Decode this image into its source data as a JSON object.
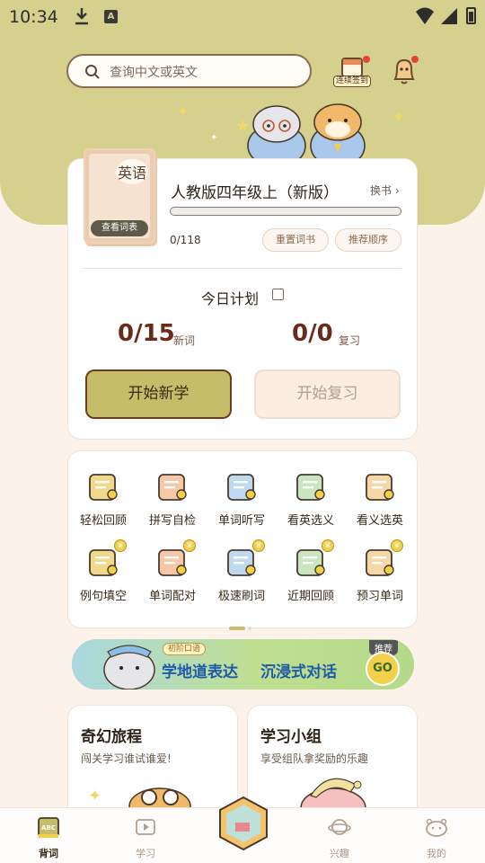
{
  "status_bar": {
    "time": "10:34"
  },
  "search": {
    "placeholder": "查询中文或英文"
  },
  "header": {
    "checkin_label": "连续签到"
  },
  "book": {
    "cover_title": "英语",
    "view_words": "查看词表",
    "title": "人教版四年级上（新版）",
    "change": "换书",
    "progress_text": "0/118",
    "progress_fraction": 0.0,
    "reset": "重置词书",
    "order": "推荐顺序"
  },
  "plan": {
    "title": "今日计划",
    "new_value": "0/15",
    "new_label": "新词",
    "review_value": "0/0",
    "review_label": "复习",
    "start_new": "开始新学",
    "start_review": "开始复习"
  },
  "functions": [
    {
      "label": "轻松回顾",
      "icon": "calendar-icon",
      "vip": false
    },
    {
      "label": "拼写自检",
      "icon": "magnifier-icon",
      "vip": false
    },
    {
      "label": "单词听写",
      "icon": "clipboard-icon",
      "vip": false
    },
    {
      "label": "看英选义",
      "icon": "flashcard-en-icon",
      "vip": false
    },
    {
      "label": "看义选英",
      "icon": "flashcard-cn-icon",
      "vip": false
    },
    {
      "label": "例句填空",
      "icon": "scroll-icon",
      "vip": true
    },
    {
      "label": "单词配对",
      "icon": "puzzle-icon",
      "vip": true
    },
    {
      "label": "极速刷词",
      "icon": "rocket-icon",
      "vip": true
    },
    {
      "label": "近期回顾",
      "icon": "headphones-icon",
      "vip": true
    },
    {
      "label": "预习单词",
      "icon": "open-book-icon",
      "vip": true
    }
  ],
  "banner": {
    "tag": "初阶口语",
    "line1": "学地道表达",
    "line2": "沉浸式对话",
    "badge": "推荐",
    "go": "GO"
  },
  "cards": [
    {
      "title": "奇幻旅程",
      "subtitle": "闯关学习谁试谁爱!"
    },
    {
      "title": "学习小组",
      "subtitle": "享受组队拿奖励的乐趣"
    }
  ],
  "nav": {
    "items": [
      "背词",
      "学习",
      "兴趣",
      "我的"
    ]
  },
  "colors": {
    "accent": "#d5d08e",
    "button": "#c5bd6a",
    "number": "#6a2c1a"
  }
}
